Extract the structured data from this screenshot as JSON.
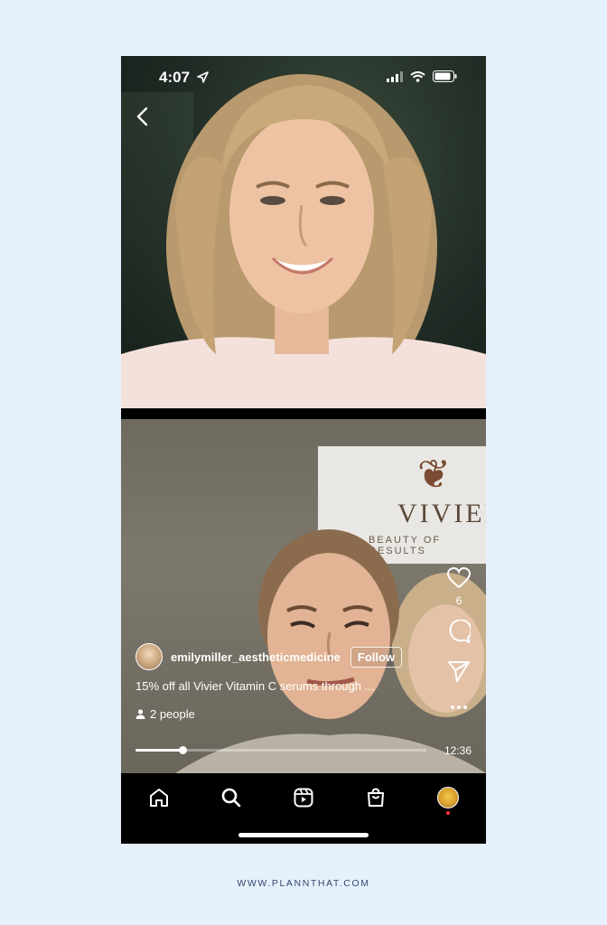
{
  "status_bar": {
    "time": "4:07"
  },
  "stream": {
    "host_username": "emilymiller_aestheticmedicine",
    "follow_label": "Follow",
    "caption": "15% off all Vivier Vitamin C serums through ...",
    "viewers": "2 people",
    "likes_count": "6",
    "duration": "12:36",
    "progress": 0.16
  },
  "banner": {
    "brand": "VIVIER",
    "tagline": "BEAUTY OF RESULTS"
  },
  "tab_bar": {
    "items": [
      {
        "icon": "home-icon"
      },
      {
        "icon": "search-icon"
      },
      {
        "icon": "reels-icon"
      },
      {
        "icon": "shop-icon"
      },
      {
        "icon": "profile-avatar"
      }
    ]
  },
  "colors": {
    "page_bg": "#e6f0fd",
    "notification": "#ff3040"
  },
  "footer": {
    "url": "WWW.PLANNTHAT.COM"
  }
}
